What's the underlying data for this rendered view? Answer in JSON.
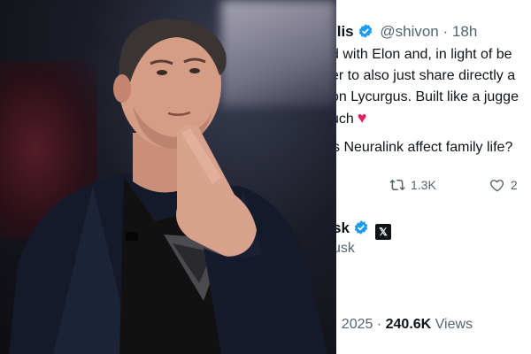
{
  "tweet": {
    "author_name_fragment": "ilis",
    "handle": "@shivon",
    "separator": "·",
    "time": "18h",
    "body_lines": [
      "d with Elon and, in light of be",
      "er to also just share directly a",
      "on Lycurgus. Built like a jugge",
      "uch"
    ],
    "heart_icon": "heart-icon",
    "quoted_text": "s Neuralink affect family life?",
    "retweet_count": "1.3K",
    "like_count": "2"
  },
  "reply_tweet": {
    "author_name_fragment": "sk",
    "handle_fragment": "usk",
    "date_fragment": "3, 2025",
    "separator": "·",
    "views_count": "240.6K",
    "views_label": "Views"
  },
  "colors": {
    "verified_blue": "#1d9bf0",
    "heart_red": "#e0245e",
    "muted_text": "#536471"
  }
}
